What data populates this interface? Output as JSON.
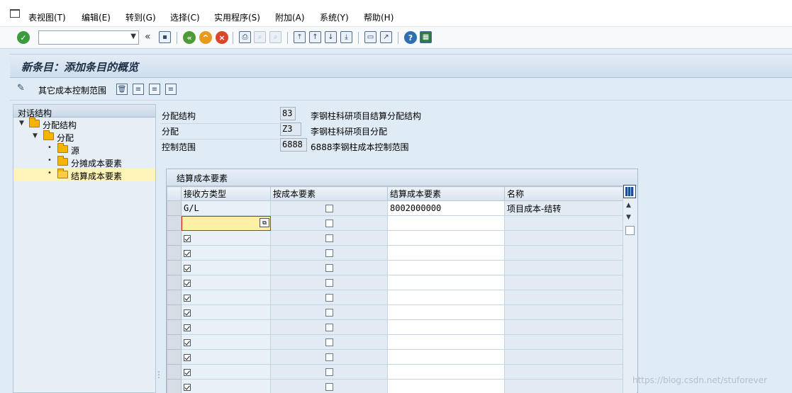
{
  "menubar": {
    "items": [
      "表视图(T)",
      "编辑(E)",
      "转到(G)",
      "选择(C)",
      "实用程序(S)",
      "附加(A)",
      "系统(Y)",
      "帮助(H)"
    ]
  },
  "toolbar": {
    "command_value": "",
    "icons": [
      "enter-icon",
      "save-icon",
      "back-icon",
      "exit-icon",
      "cancel-icon",
      "print-icon",
      "find-icon",
      "find-next-icon",
      "first-page-icon",
      "previous-page-icon",
      "next-page-icon",
      "last-page-icon",
      "create-session-icon",
      "shortcut-icon",
      "help-icon",
      "customize-icon"
    ]
  },
  "title": "新条目：添加条目的概览",
  "app_toolbar": {
    "other_area_label": "其它成本控制范围"
  },
  "tree": {
    "header": "对话结构",
    "items": [
      {
        "label": "分配结构",
        "level": 0,
        "expanded": true
      },
      {
        "label": "分配",
        "level": 1,
        "expanded": true
      },
      {
        "label": "源",
        "level": 2
      },
      {
        "label": "分摊成本要素",
        "level": 2
      },
      {
        "label": "结算成本要素",
        "level": 2,
        "selected": true
      }
    ]
  },
  "header_fields": [
    {
      "label": "分配结构",
      "value": "83",
      "desc": "李钢柱科研项目结算分配结构"
    },
    {
      "label": "分配",
      "value": "Z3",
      "desc": "李钢柱科研项目分配"
    },
    {
      "label": "控制范围",
      "value": "6888",
      "desc": "6888李钢柱成本控制范围"
    }
  ],
  "table": {
    "title": "结算成本要素",
    "columns": [
      "接收方类型",
      "按成本要素",
      "结算成本要素",
      "名称"
    ],
    "rows": [
      {
        "receiver": "G/L",
        "by_element": false,
        "element": "8002000000",
        "name": "项目成本-结转"
      }
    ]
  },
  "watermark": "https://blog.csdn.net/stuforever"
}
